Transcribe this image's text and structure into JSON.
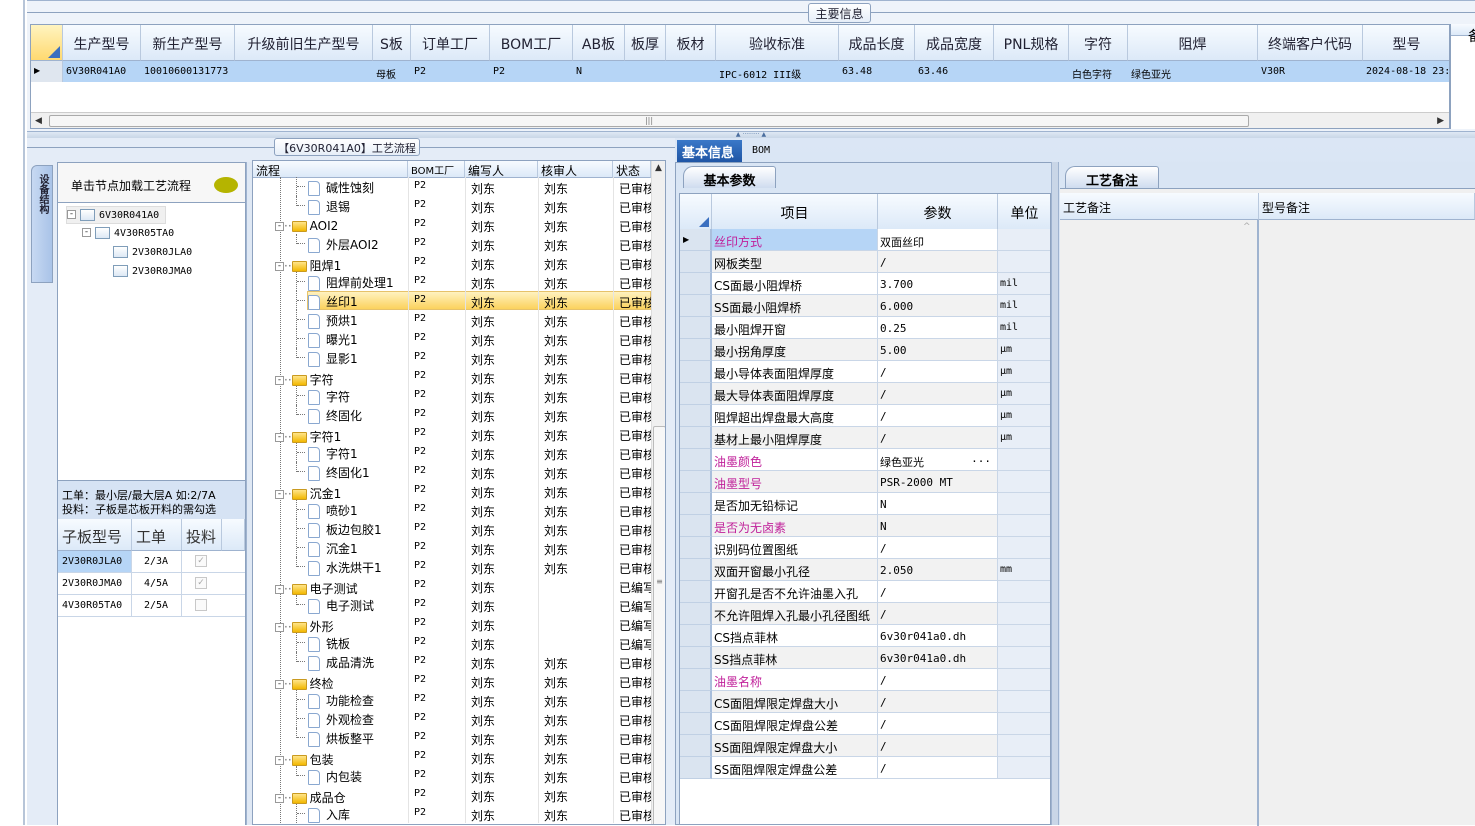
{
  "main_info": {
    "title": "主要信息",
    "columns": [
      "生产型号",
      "新生产型号",
      "升级前旧生产型号",
      "S板",
      "订单工厂",
      "BOM工厂",
      "AB板",
      "板厚",
      "板材",
      "验收标准",
      "成品长度",
      "成品宽度",
      "PNL规格",
      "字符",
      "阻焊",
      "终端客户代码",
      "型号"
    ],
    "row": [
      "6V30R041A0",
      "10010600131773",
      "",
      "母板",
      "P2",
      "P2",
      "N",
      "",
      "",
      "IPC-6012 III级",
      "63.48",
      "63.46",
      "",
      "白色字符",
      "绿色亚光",
      "V30R",
      "2024-08-18 23:"
    ],
    "side_header": "备"
  },
  "flow": {
    "title": "【6V30R041A0】工艺流程",
    "vertical_tab": "设备结构",
    "hint": "单击节点加载工艺流程",
    "tree": [
      {
        "label": "6V30R041A0",
        "level": 0
      },
      {
        "label": "4V30R05TA0",
        "level": 1
      },
      {
        "label": "2V30R0JLA0",
        "level": 2
      },
      {
        "label": "2V30R0JMA0",
        "level": 2
      }
    ],
    "note_line1": "工单：最小层/最大层A 如:2/7A",
    "note_line2": "投料：子板是芯板开料的需勾选",
    "sub_columns": [
      "子板型号",
      "工单",
      "投料"
    ],
    "sub_rows": [
      {
        "model": "2V30R0JLA0",
        "order": "2/3A",
        "feed": true
      },
      {
        "model": "2V30R0JMA0",
        "order": "4/5A",
        "feed": true
      },
      {
        "model": "4V30R05TA0",
        "order": "2/5A",
        "feed": false
      }
    ],
    "columns": [
      "流程",
      "BOM工厂",
      "编写人",
      "核审人",
      "状态"
    ],
    "selected_index": 6,
    "steps": [
      {
        "n": "碱性蚀刻",
        "f": 0,
        "last": 0,
        "b": "P2",
        "w": "刘东",
        "r": "刘东",
        "s": "已审核"
      },
      {
        "n": "退锡",
        "f": 0,
        "last": 1,
        "b": "P2",
        "w": "刘东",
        "r": "刘东",
        "s": "已审核"
      },
      {
        "n": "AOI2",
        "f": 1,
        "b": "P2",
        "w": "刘东",
        "r": "刘东",
        "s": "已审核"
      },
      {
        "n": "外层AOI2",
        "f": 0,
        "last": 1,
        "b": "P2",
        "w": "刘东",
        "r": "刘东",
        "s": "已审核"
      },
      {
        "n": "阻焊1",
        "f": 1,
        "b": "P2",
        "w": "刘东",
        "r": "刘东",
        "s": "已审核"
      },
      {
        "n": "阻焊前处理1",
        "f": 0,
        "b": "P2",
        "w": "刘东",
        "r": "刘东",
        "s": "已审核"
      },
      {
        "n": "丝印1",
        "f": 0,
        "b": "P2",
        "w": "刘东",
        "r": "刘东",
        "s": "已审核"
      },
      {
        "n": "预烘1",
        "f": 0,
        "b": "P2",
        "w": "刘东",
        "r": "刘东",
        "s": "已审核"
      },
      {
        "n": "曝光1",
        "f": 0,
        "b": "P2",
        "w": "刘东",
        "r": "刘东",
        "s": "已审核"
      },
      {
        "n": "显影1",
        "f": 0,
        "last": 1,
        "b": "P2",
        "w": "刘东",
        "r": "刘东",
        "s": "已审核"
      },
      {
        "n": "字符",
        "f": 1,
        "b": "P2",
        "w": "刘东",
        "r": "刘东",
        "s": "已审核"
      },
      {
        "n": "字符",
        "f": 0,
        "b": "P2",
        "w": "刘东",
        "r": "刘东",
        "s": "已审核"
      },
      {
        "n": "终固化",
        "f": 0,
        "last": 1,
        "b": "P2",
        "w": "刘东",
        "r": "刘东",
        "s": "已审核"
      },
      {
        "n": "字符1",
        "f": 1,
        "b": "P2",
        "w": "刘东",
        "r": "刘东",
        "s": "已审核"
      },
      {
        "n": "字符1",
        "f": 0,
        "b": "P2",
        "w": "刘东",
        "r": "刘东",
        "s": "已审核"
      },
      {
        "n": "终固化1",
        "f": 0,
        "last": 1,
        "b": "P2",
        "w": "刘东",
        "r": "刘东",
        "s": "已审核"
      },
      {
        "n": "沉金1",
        "f": 1,
        "b": "P2",
        "w": "刘东",
        "r": "刘东",
        "s": "已审核"
      },
      {
        "n": "喷砂1",
        "f": 0,
        "b": "P2",
        "w": "刘东",
        "r": "刘东",
        "s": "已审核"
      },
      {
        "n": "板边包胶1",
        "f": 0,
        "b": "P2",
        "w": "刘东",
        "r": "刘东",
        "s": "已审核"
      },
      {
        "n": "沉金1",
        "f": 0,
        "b": "P2",
        "w": "刘东",
        "r": "刘东",
        "s": "已审核"
      },
      {
        "n": "水洗烘干1",
        "f": 0,
        "last": 1,
        "b": "P2",
        "w": "刘东",
        "r": "刘东",
        "s": "已审核"
      },
      {
        "n": "电子测试",
        "f": 1,
        "b": "P2",
        "w": "刘东",
        "r": "",
        "s": "已编写"
      },
      {
        "n": "电子测试",
        "f": 0,
        "last": 1,
        "b": "P2",
        "w": "刘东",
        "r": "",
        "s": "已编写"
      },
      {
        "n": "外形",
        "f": 1,
        "b": "P2",
        "w": "刘东",
        "r": "",
        "s": "已编写"
      },
      {
        "n": "铣板",
        "f": 0,
        "b": "P2",
        "w": "刘东",
        "r": "",
        "s": "已编写"
      },
      {
        "n": "成品清洗",
        "f": 0,
        "last": 1,
        "b": "P2",
        "w": "刘东",
        "r": "刘东",
        "s": "已审核"
      },
      {
        "n": "终检",
        "f": 1,
        "b": "P2",
        "w": "刘东",
        "r": "刘东",
        "s": "已审核"
      },
      {
        "n": "功能检查",
        "f": 0,
        "b": "P2",
        "w": "刘东",
        "r": "刘东",
        "s": "已审核"
      },
      {
        "n": "外观检查",
        "f": 0,
        "b": "P2",
        "w": "刘东",
        "r": "刘东",
        "s": "已审核"
      },
      {
        "n": "烘板整平",
        "f": 0,
        "last": 1,
        "b": "P2",
        "w": "刘东",
        "r": "刘东",
        "s": "已审核"
      },
      {
        "n": "包装",
        "f": 1,
        "b": "P2",
        "w": "刘东",
        "r": "刘东",
        "s": "已审核"
      },
      {
        "n": "内包装",
        "f": 0,
        "last": 1,
        "b": "P2",
        "w": "刘东",
        "r": "刘东",
        "s": "已审核"
      },
      {
        "n": "成品仓",
        "f": 1,
        "b": "P2",
        "w": "刘东",
        "r": "刘东",
        "s": "已审核"
      },
      {
        "n": "入库",
        "f": 0,
        "b": "P2",
        "w": "刘东",
        "r": "刘东",
        "s": "已审核"
      }
    ]
  },
  "detail": {
    "tabs": [
      "基本信息",
      "BOM"
    ],
    "active_tab": "基本信息",
    "subtab": "基本参数",
    "columns": [
      "项目",
      "参数",
      "单位"
    ],
    "highlight_color": "#c0209a",
    "params": [
      {
        "k": "丝印方式",
        "v": "双面丝印",
        "u": "",
        "m": 1
      },
      {
        "k": "网板类型",
        "v": "/",
        "u": ""
      },
      {
        "k": "CS面最小阻焊桥",
        "v": "3.700",
        "u": "mil"
      },
      {
        "k": "SS面最小阻焊桥",
        "v": "6.000",
        "u": "mil"
      },
      {
        "k": "最小阻焊开窗",
        "v": "0.25",
        "u": "mil"
      },
      {
        "k": "最小拐角厚度",
        "v": "5.00",
        "u": "μm"
      },
      {
        "k": "最小导体表面阻焊厚度",
        "v": "/",
        "u": "μm"
      },
      {
        "k": "最大导体表面阻焊厚度",
        "v": "/",
        "u": "μm"
      },
      {
        "k": "阻焊超出焊盘最大高度",
        "v": "/",
        "u": "μm"
      },
      {
        "k": "基材上最小阻焊厚度",
        "v": "/",
        "u": "μm"
      },
      {
        "k": "油墨颜色",
        "v": "绿色亚光",
        "u": "",
        "m": 1,
        "more": "..."
      },
      {
        "k": "油墨型号",
        "v": "PSR-2000 MT",
        "u": "",
        "m": 1
      },
      {
        "k": "是否加无铅标记",
        "v": "N",
        "u": ""
      },
      {
        "k": "是否为无卤素",
        "v": "N",
        "u": "",
        "m": 1
      },
      {
        "k": "识别码位置图纸",
        "v": "/",
        "u": ""
      },
      {
        "k": "双面开窗最小孔径",
        "v": "2.050",
        "u": "mm"
      },
      {
        "k": "开窗孔是否不允许油墨入孔",
        "v": "/",
        "u": ""
      },
      {
        "k": "不允许阻焊入孔最小孔径图纸",
        "v": "/",
        "u": ""
      },
      {
        "k": "CS挡点菲林",
        "v": "6v30r041a0.dh",
        "u": ""
      },
      {
        "k": "SS挡点菲林",
        "v": "6v30r041a0.dh",
        "u": ""
      },
      {
        "k": "油墨名称",
        "v": "/",
        "u": "",
        "m": 1
      },
      {
        "k": "CS面阻焊限定焊盘大小",
        "v": "/",
        "u": ""
      },
      {
        "k": "CS面阻焊限定焊盘公差",
        "v": "/",
        "u": ""
      },
      {
        "k": "SS面阻焊限定焊盘大小",
        "v": "/",
        "u": ""
      },
      {
        "k": "SS面阻焊限定焊盘公差",
        "v": "/",
        "u": ""
      }
    ]
  },
  "remarks": {
    "tab": "工艺备注",
    "columns": [
      "工艺备注",
      "型号备注"
    ]
  }
}
